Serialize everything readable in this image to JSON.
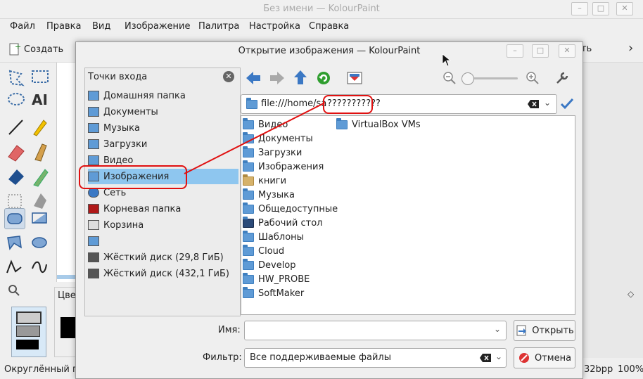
{
  "main_window": {
    "title": "Без имени — KolourPaint",
    "menu": [
      "Файл",
      "Правка",
      "Вид",
      "Изображение",
      "Палитра",
      "Настройка",
      "Справка"
    ],
    "toolbar_create": "Создать",
    "toolbar_partial": "ть",
    "color_partial": "Цве",
    "status_left": "Округлённый пр",
    "status_bpp": "32bpp",
    "status_zoom": "100%"
  },
  "dialog": {
    "title": "Открытие изображения — KolourPaint",
    "places_title": "Точки входа",
    "places": [
      {
        "label": "Домашняя папка",
        "icon": "folder-icon"
      },
      {
        "label": "Документы",
        "icon": "folder-icon"
      },
      {
        "label": "Музыка",
        "icon": "music-folder-icon"
      },
      {
        "label": "Загрузки",
        "icon": "downloads-folder-icon"
      },
      {
        "label": "Видео",
        "icon": "video-folder-icon"
      },
      {
        "label": "Изображения",
        "icon": "pictures-folder-icon",
        "selected": true
      },
      {
        "label": "Сеть",
        "icon": "network-icon"
      },
      {
        "label": "Корневая папка",
        "icon": "root-folder-icon"
      },
      {
        "label": "Корзина",
        "icon": "trash-icon"
      },
      {
        "label": "",
        "icon": "folder-icon"
      },
      {
        "label": "Жёсткий диск (29,8 ГиБ)",
        "icon": "harddisk-icon"
      },
      {
        "label": "Жёсткий диск (432,1 ГиБ)",
        "icon": "harddisk-icon"
      }
    ],
    "url_prefix": "file:///home/sa",
    "url_garbled": "???????????",
    "files_col1": [
      {
        "name": "Видео",
        "icon": "folder-icon"
      },
      {
        "name": "Документы",
        "icon": "folder-icon"
      },
      {
        "name": "Загрузки",
        "icon": "folder-icon"
      },
      {
        "name": "Изображения",
        "icon": "folder-icon"
      },
      {
        "name": "книги",
        "icon": "folder-tan-icon"
      },
      {
        "name": "Музыка",
        "icon": "folder-icon"
      },
      {
        "name": "Общедоступные",
        "icon": "folder-icon"
      },
      {
        "name": "Рабочий стол",
        "icon": "desktop-icon"
      },
      {
        "name": "Шаблоны",
        "icon": "folder-icon"
      },
      {
        "name": "Cloud",
        "icon": "folder-icon"
      },
      {
        "name": "Develop",
        "icon": "folder-icon"
      },
      {
        "name": "HW_PROBE",
        "icon": "folder-icon"
      },
      {
        "name": "SoftMaker",
        "icon": "folder-icon"
      }
    ],
    "files_col2": [
      {
        "name": "VirtualBox VMs",
        "icon": "folder-icon"
      }
    ],
    "name_label": "Имя:",
    "name_value": "",
    "filter_label": "Фильтр:",
    "filter_value": "Все поддерживаемые файлы",
    "open_button": "Открыть",
    "cancel_button": "Отмена"
  },
  "colors": {
    "selection": "#8ec6ef",
    "annotation": "#e01010",
    "folder_blue": "#5f9bd6"
  }
}
